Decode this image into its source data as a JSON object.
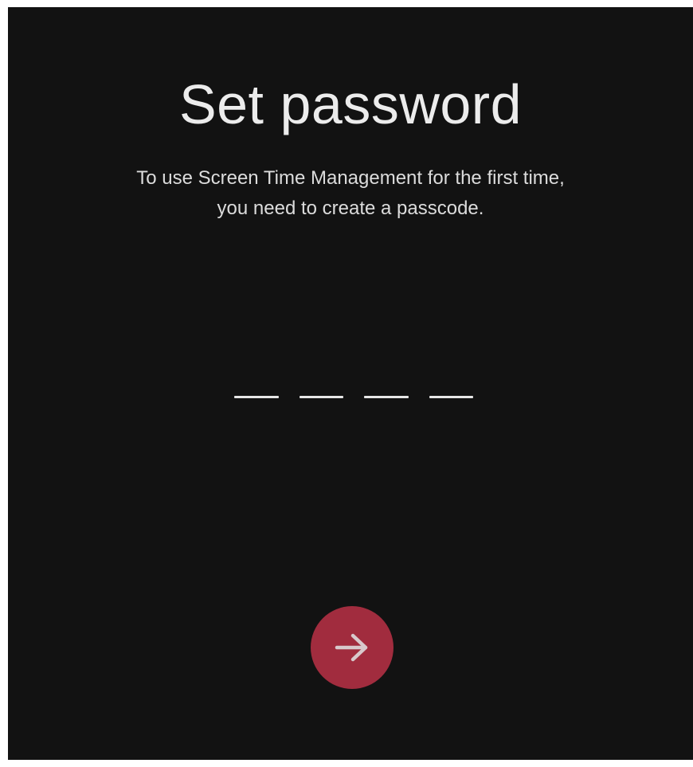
{
  "page": {
    "title": "Set password",
    "subtitle_line1": "To use Screen Time Management for the first time,",
    "subtitle_line2": "you need to create a passcode."
  },
  "passcode": {
    "length": 4,
    "entered": 0
  },
  "next_button": {
    "icon": "arrow-right-icon",
    "color": "#a12c3e"
  },
  "colors": {
    "background": "#121212",
    "text": "#ececec"
  }
}
